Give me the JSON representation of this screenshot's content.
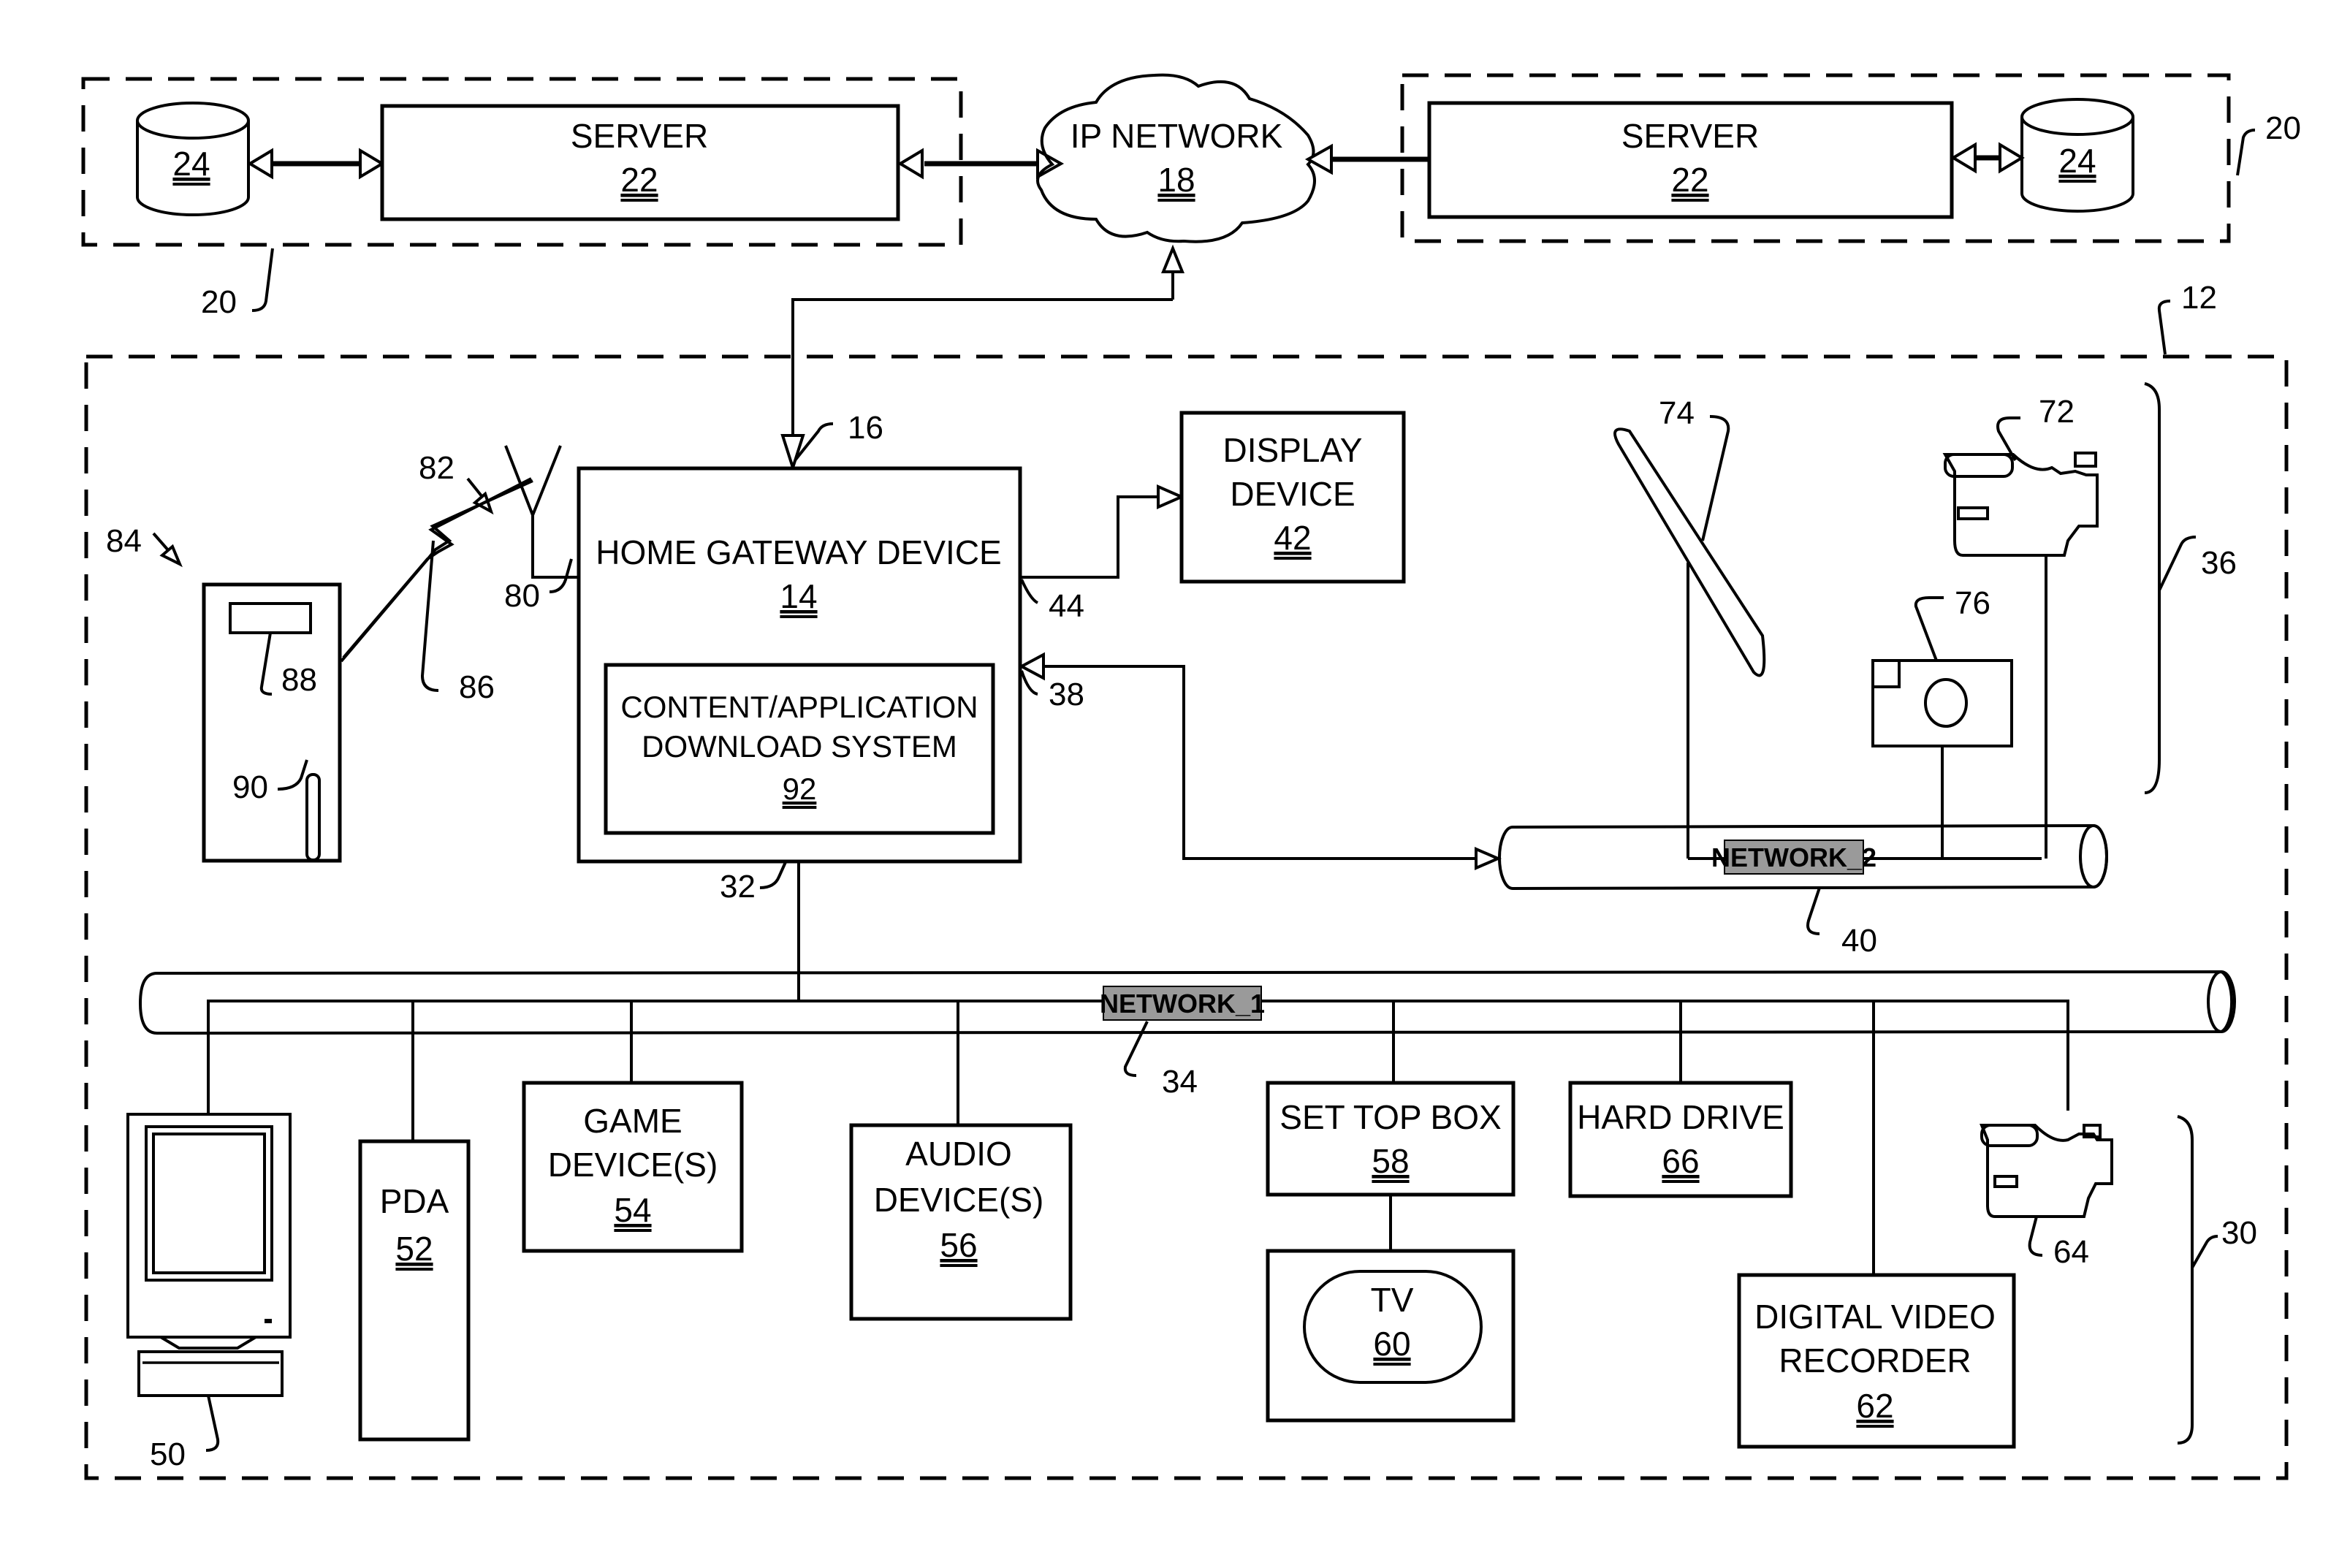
{
  "figure": {
    "ip_network": {
      "label": "IP NETWORK",
      "ref": "18"
    },
    "server_left": {
      "label": "SERVER",
      "ref": "22"
    },
    "server_right": {
      "label": "SERVER",
      "ref": "22"
    },
    "db_left": {
      "ref": "24"
    },
    "db_right": {
      "ref": "24"
    },
    "server_group_left_ref": "20",
    "server_group_right_ref": "20",
    "home_network_ref": "12",
    "gateway": {
      "label": "HOME GATEWAY DEVICE",
      "ref": "14"
    },
    "download_system": {
      "line1": "CONTENT/APPLICATION",
      "line2": "DOWNLOAD  SYSTEM",
      "ref": "92"
    },
    "display_device": {
      "line1": "DISPLAY",
      "line2": "DEVICE",
      "ref": "42"
    },
    "network1": {
      "label": "NETWORK_1",
      "ref": "34"
    },
    "network2": {
      "label": "NETWORK_2",
      "ref": "40"
    },
    "refs": {
      "link_16": "16",
      "antenna_82": "82",
      "port_80": "80",
      "pc_84": "84",
      "wireless_86": "86",
      "display_88": "88",
      "slot_90": "90",
      "link_44": "44",
      "link_38": "38",
      "link_32": "32",
      "sensor_74": "74",
      "camcorder_72": "72",
      "camera_76": "76",
      "group_36": "36",
      "group_30": "30",
      "computer_50": "50",
      "camcorder_64": "64"
    },
    "pda": {
      "label": "PDA",
      "ref": "52"
    },
    "game": {
      "line1": "GAME",
      "line2": "DEVICE(S)",
      "ref": "54"
    },
    "audio": {
      "line1": "AUDIO",
      "line2": "DEVICE(S)",
      "ref": "56"
    },
    "stb": {
      "label": "SET TOP BOX",
      "ref": "58"
    },
    "tv": {
      "label": "TV",
      "ref": "60"
    },
    "hdd": {
      "label": "HARD DRIVE",
      "ref": "66"
    },
    "dvr": {
      "line1": "DIGITAL VIDEO",
      "line2": "RECORDER",
      "ref": "62"
    }
  }
}
